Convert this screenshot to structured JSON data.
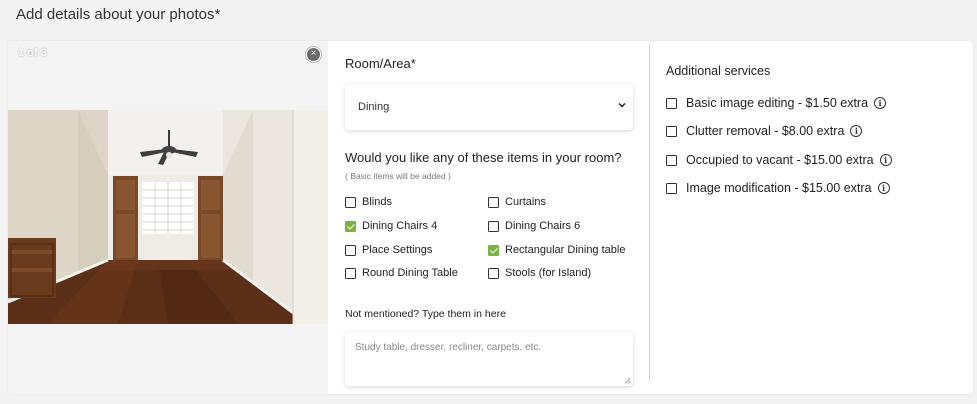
{
  "page": {
    "heading": "Add details about your photos*"
  },
  "photo": {
    "counter": "1 of 3",
    "close_glyph": "×",
    "close_icon": "close-circle-icon"
  },
  "room": {
    "label": "Room/Area*",
    "selected": "Dining",
    "icon": "chevron-down-icon"
  },
  "items_section": {
    "question": "Would you like any of these items in your room?",
    "subnote": "( Basic items will be added )",
    "items": [
      {
        "label": "Blinds",
        "checked": false
      },
      {
        "label": "Curtains",
        "checked": false
      },
      {
        "label": "Dining Chairs 4",
        "checked": true
      },
      {
        "label": "Dining Chairs 6",
        "checked": false
      },
      {
        "label": "Place Settings",
        "checked": false
      },
      {
        "label": "Rectangular Dining table",
        "checked": true
      },
      {
        "label": "Round Dining Table",
        "checked": false
      },
      {
        "label": "Stools (for Island)",
        "checked": false
      }
    ]
  },
  "not_mentioned": {
    "label": "Not mentioned? Type them in here",
    "placeholder": "Study table, dresser, recliner, carpets. etc.",
    "value": ""
  },
  "services": {
    "label": "Additional services",
    "info_glyph": "i",
    "items": [
      {
        "label": "Basic image editing - $1.50 extra",
        "checked": false
      },
      {
        "label": "Clutter removal - $8.00 extra",
        "checked": false
      },
      {
        "label": "Occupied to vacant - $15.00 extra",
        "checked": false
      },
      {
        "label": "Image modification - $15.00 extra",
        "checked": false
      }
    ]
  },
  "colors": {
    "check_green": "#7cb242",
    "card_bg": "#ffffff",
    "page_bg": "#f3f3f3"
  }
}
